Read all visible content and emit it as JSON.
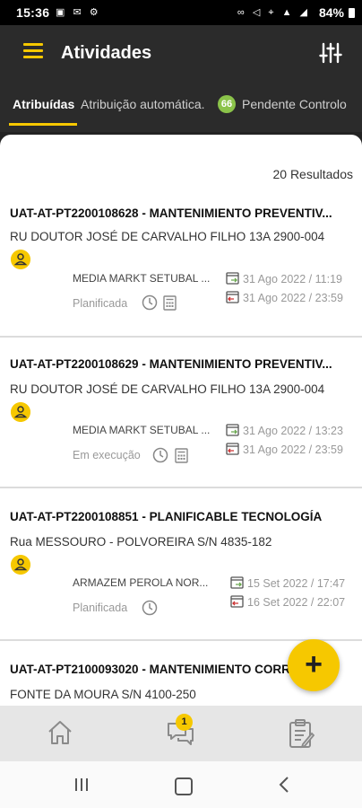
{
  "status_bar": {
    "time": "15:36",
    "battery": "84%"
  },
  "app_bar": {
    "title": "Atividades",
    "menu_icon": "menu-icon",
    "filter_icon": "sliders-icon"
  },
  "tabs": [
    {
      "label": "Atribuídas",
      "active": true
    },
    {
      "label": "Atribuição automática."
    },
    {
      "label": "Pendente Controlo",
      "badge": "66"
    }
  ],
  "results_label": "20 Resultados",
  "cards": [
    {
      "title": "UAT-AT-PT2200108628 - MANTENIMIENTO PREVENTIV...",
      "address": "RU DOUTOR JOSÉ DE CARVALHO FILHO 13A 2900-004",
      "store": "MEDIA MARKT SETUBAL ...",
      "state": "Planificada",
      "start": "31 Ago 2022 / 11:19",
      "end": "31 Ago 2022 / 23:59"
    },
    {
      "title": "UAT-AT-PT2200108629 - MANTENIMIENTO PREVENTIV...",
      "address": "RU DOUTOR JOSÉ DE CARVALHO FILHO 13A 2900-004",
      "store": "MEDIA MARKT SETUBAL ...",
      "state": "Em execução",
      "start": "31 Ago 2022 / 13:23",
      "end": "31 Ago 2022 / 23:59"
    },
    {
      "title": "UAT-AT-PT2200108851 - PLANIFICABLE TECNOLOGÍA",
      "address": "Rua MESSOURO - POLVOREIRA S/N 4835-182",
      "store": "ARMAZEM PEROLA NOR...",
      "state": "Planificada",
      "start": "15 Set 2022 / 17:47",
      "end": "16 Set 2022 / 22:07"
    },
    {
      "title": "UAT-AT-PT2100093020 - MANTENIMIENTO CORRECTIVO",
      "address": "FONTE DA MOURA S/N 4100-250"
    }
  ],
  "fab": {
    "label": "+"
  },
  "bottom_nav": {
    "chat_badge": "1"
  },
  "colors": {
    "accent": "#f6c800",
    "header": "#2b2b2b",
    "badge_green": "#8bc34a"
  }
}
